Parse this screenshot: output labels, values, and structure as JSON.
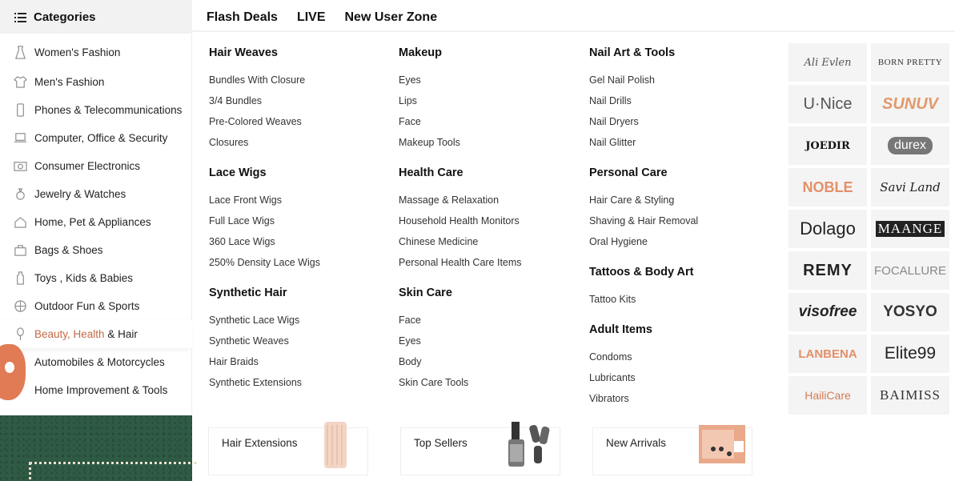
{
  "categories": {
    "header_label": "Categories",
    "items": [
      {
        "label": "Women's Fashion",
        "icon": "dress-icon"
      },
      {
        "label": "Men's Fashion",
        "icon": "shirt-icon"
      },
      {
        "label": "Phones & Telecommunications",
        "icon": "phone-icon"
      },
      {
        "label": "Computer, Office & Security",
        "icon": "laptop-icon"
      },
      {
        "label": "Consumer Electronics",
        "icon": "camera-icon"
      },
      {
        "label": "Jewelry & Watches",
        "icon": "ring-icon"
      },
      {
        "label": "Home, Pet & Appliances",
        "icon": "home-icon"
      },
      {
        "label": "Bags & Shoes",
        "icon": "bag-icon"
      },
      {
        "label": "Toys , Kids & Babies",
        "icon": "bottle-icon"
      },
      {
        "label": "Outdoor Fun & Sports",
        "icon": "ball-icon"
      },
      {
        "label_a": "Beauty, Health",
        "label_b": " & Hair",
        "icon": "brush-icon"
      },
      {
        "label": "Automobiles & Motorcycles",
        "icon": "car-icon"
      },
      {
        "label": "Home Improvement & Tools",
        "icon": "tools-icon"
      }
    ]
  },
  "top_nav": {
    "flash_deals": "Flash Deals",
    "live": "LIVE",
    "new_user_zone": "New User Zone"
  },
  "menu": {
    "col1": [
      {
        "title": "Hair Weaves",
        "links": [
          "Bundles With Closure",
          "3/4 Bundles",
          "Pre-Colored Weaves",
          "Closures"
        ]
      },
      {
        "title": "Lace Wigs",
        "links": [
          "Lace Front Wigs",
          "Full Lace Wigs",
          "360 Lace Wigs",
          "250% Density Lace Wigs"
        ]
      },
      {
        "title": "Synthetic Hair",
        "links": [
          "Synthetic Lace Wigs",
          "Synthetic Weaves",
          "Hair Braids",
          "Synthetic Extensions"
        ]
      }
    ],
    "col2": [
      {
        "title": "Makeup",
        "links": [
          "Eyes",
          "Lips",
          "Face",
          "Makeup Tools"
        ]
      },
      {
        "title": "Health Care",
        "links": [
          "Massage & Relaxation",
          "Household Health Monitors",
          "Chinese Medicine",
          "Personal Health Care Items"
        ]
      },
      {
        "title": "Skin Care",
        "links": [
          "Face",
          "Eyes",
          "Body",
          "Skin Care Tools"
        ]
      }
    ],
    "col3": [
      {
        "title": "Nail Art & Tools",
        "links": [
          "Gel Nail Polish",
          "Nail Drills",
          "Nail Dryers",
          "Nail Glitter"
        ]
      },
      {
        "title": "Personal Care",
        "links": [
          "Hair Care & Styling",
          "Shaving & Hair Removal",
          "Oral Hygiene"
        ]
      },
      {
        "title": "Tattoos & Body Art",
        "links": [
          "Tattoo Kits"
        ]
      },
      {
        "title": "Adult Items",
        "links": [
          "Condoms",
          "Lubricants",
          "Vibrators"
        ]
      }
    ]
  },
  "promos": [
    "Hair Extensions",
    "Top Sellers",
    "New Arrivals"
  ],
  "brands": [
    "Ali Evlen",
    "BORN PRETTY",
    "U·Nice",
    "SUNUV",
    "JOEDIR",
    "durex",
    "NOBLE",
    "Savi Land",
    "Dolago",
    "MAANGE",
    "REMY",
    "FOCALLURE",
    "visofree",
    "YOSYO",
    "LANBENA",
    "Elite99",
    "HailiCare",
    "BAIMISS"
  ],
  "colors": {
    "active_accent": "#c26a48",
    "banner_green": "#2f5b45"
  }
}
